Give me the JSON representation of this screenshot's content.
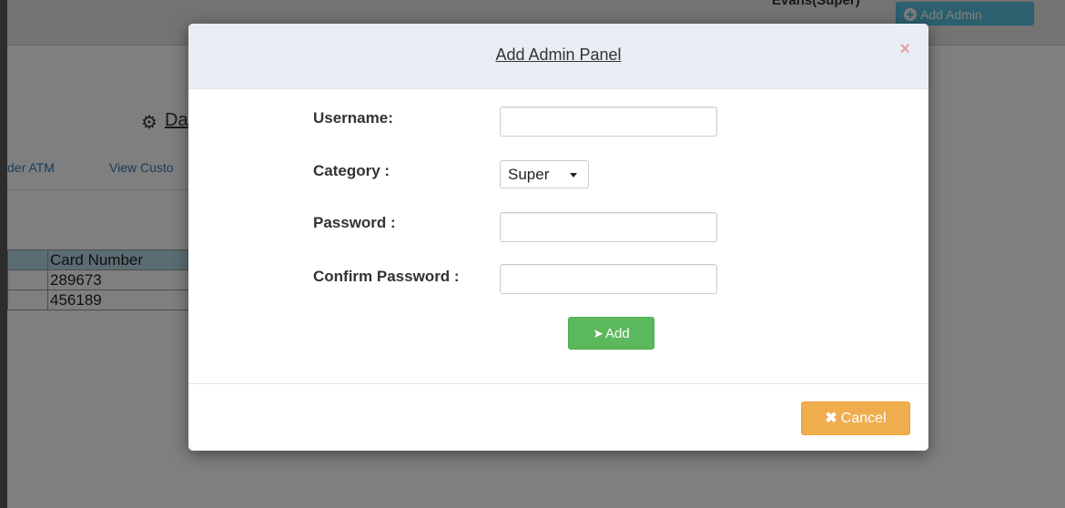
{
  "header": {
    "user_label": "Evans(Super)",
    "add_admin_label": "Add Admin"
  },
  "dashboard": {
    "title": "Da",
    "nav": [
      "der ATM",
      "View Custo"
    ]
  },
  "table": {
    "headers": [
      "",
      "Card Number"
    ],
    "rows": [
      [
        "",
        "289673"
      ],
      [
        "",
        "456189"
      ]
    ]
  },
  "modal": {
    "title": "Add Admin Panel",
    "close": "×",
    "fields": {
      "username_label": "Username:",
      "category_label": "Category :",
      "password_label": "Password :",
      "confirm_label": "Confirm Password :",
      "category_value": "Super",
      "username_value": "",
      "password_value": "",
      "confirm_value": ""
    },
    "add_label": "Add",
    "cancel_label": "Cancel"
  },
  "icons": {
    "settings": "gear-icon",
    "add_admin": "plus-circle-icon",
    "add": "paper-plane-icon",
    "cancel": "times-icon",
    "close": "close-icon"
  },
  "colors": {
    "add_admin_button": "#5bc0de",
    "add_button": "#5cb85c",
    "cancel_button": "#f0ad4e",
    "table_header": "#b7dbe6"
  }
}
